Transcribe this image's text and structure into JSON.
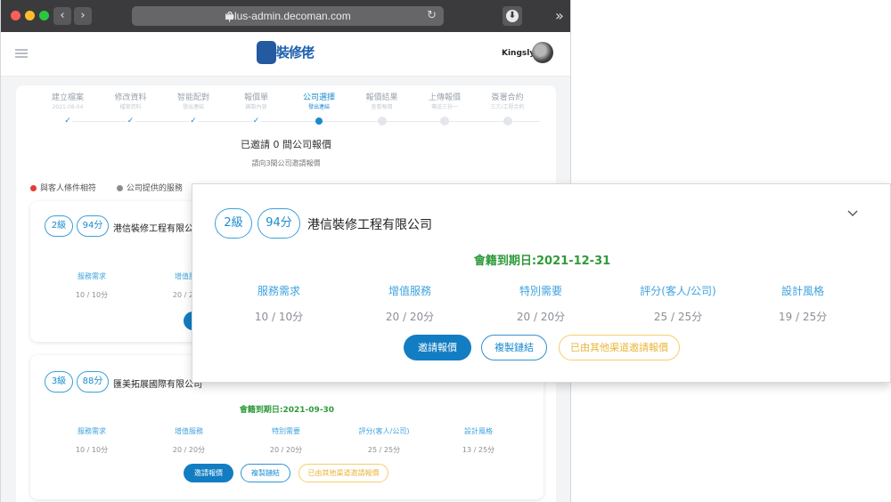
{
  "browser": {
    "url": "rplus-admin.decoman.com",
    "back_glyph": "‹",
    "forward_glyph": "›",
    "reload_glyph": "↻",
    "more_glyph": "»",
    "download_glyph": "⬇"
  },
  "header": {
    "logo_text": "裝修佬",
    "user_name": "Kingsly"
  },
  "steps": [
    {
      "label": "建立檔案",
      "sub": "2021-08-04",
      "state": "done"
    },
    {
      "label": "修改資料",
      "sub": "檔案資料",
      "state": "done"
    },
    {
      "label": "智能配對",
      "sub": "發出連結",
      "state": "done"
    },
    {
      "label": "報價單",
      "sub": "編製內容",
      "state": "done"
    },
    {
      "label": "公司選擇",
      "sub": "發出連結",
      "state": "current"
    },
    {
      "label": "報價結果",
      "sub": "查看報價",
      "state": "todo"
    },
    {
      "label": "上傳報價",
      "sub": "傳送三份一",
      "state": "todo"
    },
    {
      "label": "簽署合約",
      "sub": "三方/工程合約",
      "state": "todo"
    }
  ],
  "invite": {
    "title": "已邀請 0 間公司報價",
    "subtitle": "請向3間公司邀請報價"
  },
  "legend": [
    {
      "label": "與客人條件相符",
      "color": "#e63a35"
    },
    {
      "label": "公司提供的服務",
      "color": "#8c8c8c"
    }
  ],
  "companies": [
    {
      "level": "2級",
      "score": "94分",
      "name": "港信裝修工程有限公司",
      "expiry": "會籍到期日:2021-12-31",
      "metrics": [
        {
          "label": "服務需求",
          "value": "10 / 10分"
        },
        {
          "label": "增值服務",
          "value": "20 / 20分"
        },
        {
          "label": "特別需要",
          "value": "20 / 20分"
        },
        {
          "label": "評分(客人/公司)",
          "value": "25 / 25分"
        },
        {
          "label": "設計風格",
          "value": "19 / 25分"
        }
      ],
      "buttons": {
        "invite": "邀請報價",
        "copy": "複製鏈結",
        "other": "已由其他渠道邀請報價"
      }
    },
    {
      "level": "3級",
      "score": "88分",
      "name": "匯美拓展國際有限公司",
      "expiry": "會籍到期日:2021-09-30",
      "metrics": [
        {
          "label": "服務需求",
          "value": "10 / 10分"
        },
        {
          "label": "增值服務",
          "value": "20 / 20分"
        },
        {
          "label": "特別需要",
          "value": "20 / 20分"
        },
        {
          "label": "評分(客人/公司)",
          "value": "25 / 25分"
        },
        {
          "label": "設計風格",
          "value": "13 / 25分"
        }
      ],
      "buttons": {
        "invite": "邀請報價",
        "copy": "複製鏈結",
        "other": "已由其他渠道邀請報價"
      }
    }
  ],
  "colors": {
    "accent": "#1a8bcf",
    "primary_button": "#127dc2",
    "expiry_green": "#2f9a3a",
    "warn_border": "#f4cf6b"
  },
  "icons": [
    "lock-icon",
    "reload-icon",
    "download-icon",
    "menu-icon",
    "chevron-down-icon",
    "check-icon"
  ]
}
